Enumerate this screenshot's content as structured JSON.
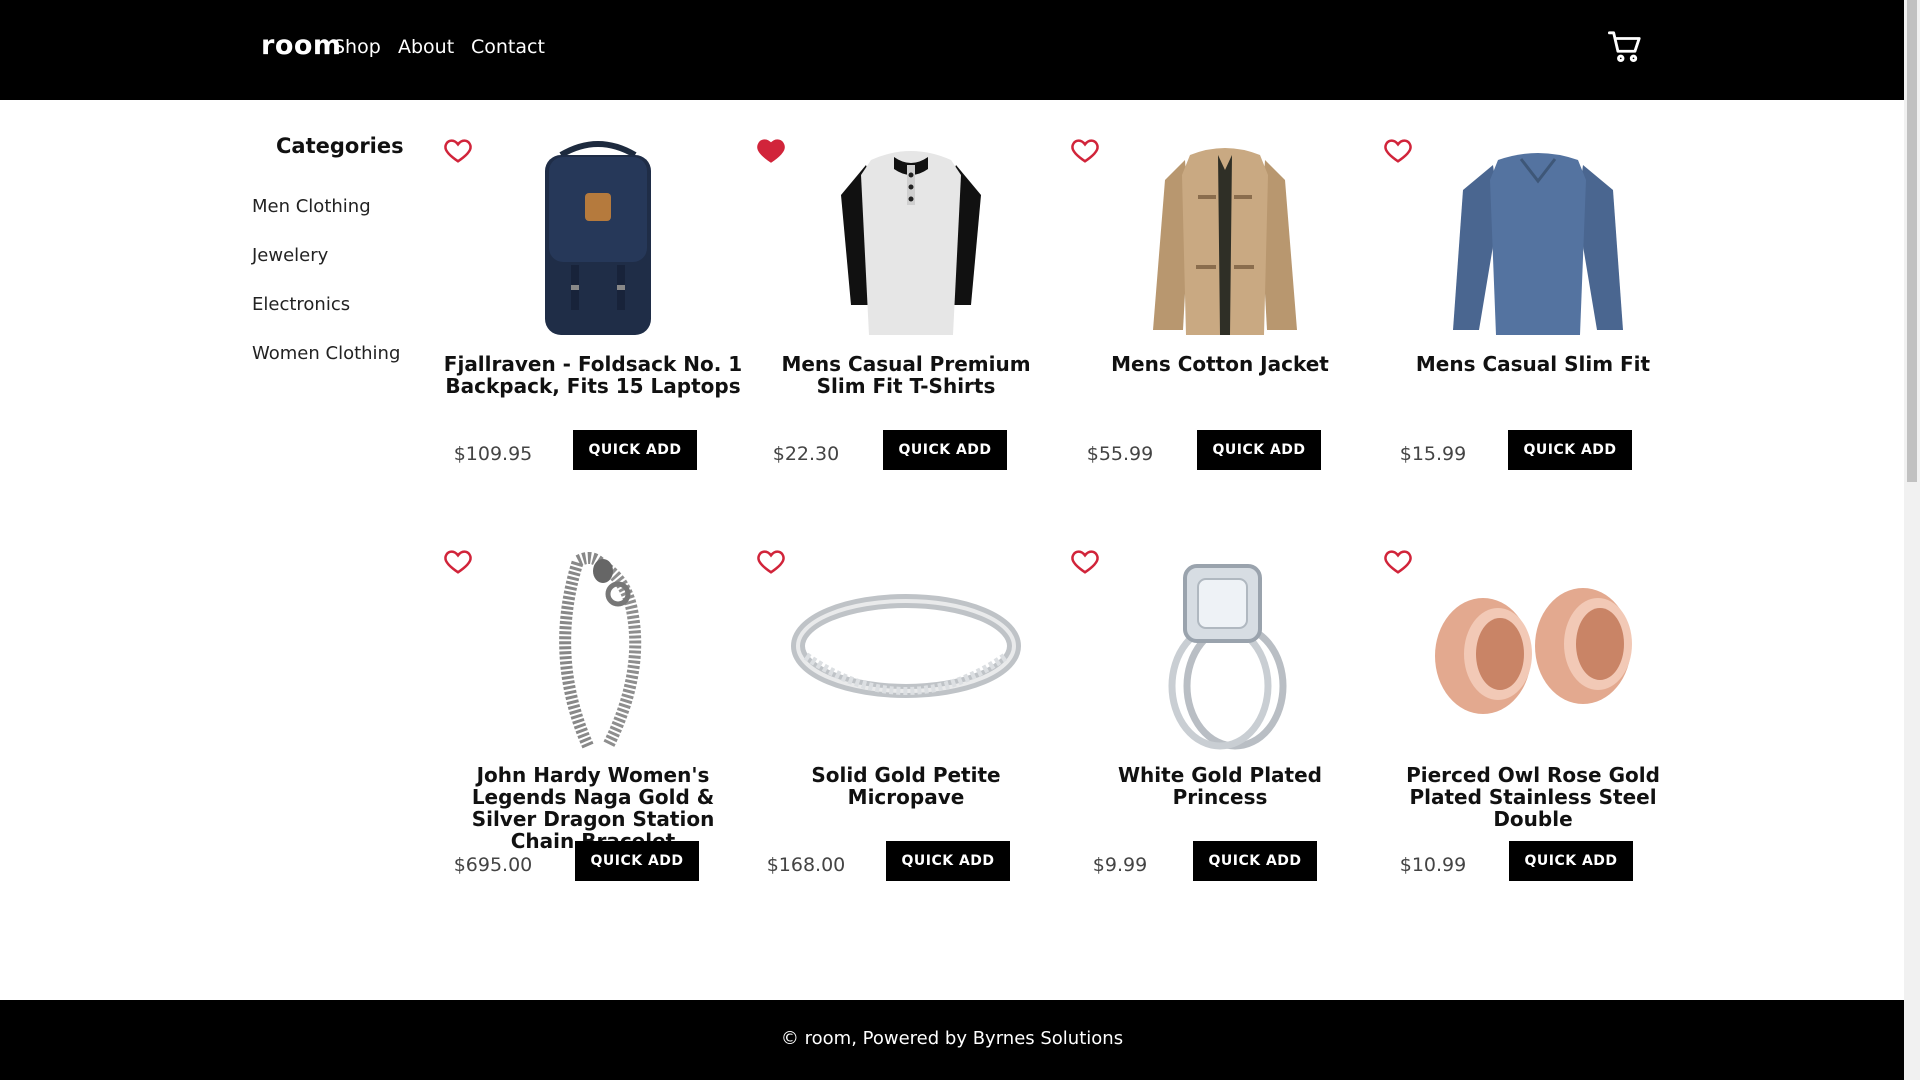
{
  "nav": {
    "brand": "room",
    "links": [
      "Shop",
      "About",
      "Contact"
    ],
    "cart_icon": "cart-icon"
  },
  "sidebar": {
    "title": "Categories",
    "items": [
      "Men Clothing",
      "Jewelery",
      "Electronics",
      "Women Clothing"
    ]
  },
  "colors": {
    "header_bg": "#000000",
    "heart": "#d1243a",
    "button_bg": "#000000"
  },
  "products": [
    {
      "title": "Fjallraven - Foldsack No. 1 Backpack, Fits 15 Laptops",
      "price": "$109.95",
      "button": "QUICK ADD",
      "favorited": false,
      "image": "backpack"
    },
    {
      "title": "Mens Casual Premium Slim Fit T-Shirts",
      "price": "$22.30",
      "button": "QUICK ADD",
      "favorited": true,
      "image": "t-shirt"
    },
    {
      "title": "Mens Cotton Jacket",
      "price": "$55.99",
      "button": "QUICK ADD",
      "favorited": false,
      "image": "jacket"
    },
    {
      "title": "Mens Casual Slim Fit",
      "price": "$15.99",
      "button": "QUICK ADD",
      "favorited": false,
      "image": "long-sleeve-shirt"
    },
    {
      "title": "John Hardy Women's Legends Naga Gold & Silver Dragon Station Chain Bracelet",
      "price": "$695.00",
      "button": "QUICK ADD",
      "favorited": false,
      "image": "bracelet"
    },
    {
      "title": "Solid Gold Petite Micropave",
      "price": "$168.00",
      "button": "QUICK ADD",
      "favorited": false,
      "image": "band-ring"
    },
    {
      "title": "White Gold Plated Princess",
      "price": "$9.99",
      "button": "QUICK ADD",
      "favorited": false,
      "image": "diamond-ring"
    },
    {
      "title": "Pierced Owl Rose Gold Plated Stainless Steel Double",
      "price": "$10.99",
      "button": "QUICK ADD",
      "favorited": false,
      "image": "rose-gold-plugs"
    }
  ],
  "footer": {
    "text": "© room, Powered by Byrnes Solutions"
  }
}
